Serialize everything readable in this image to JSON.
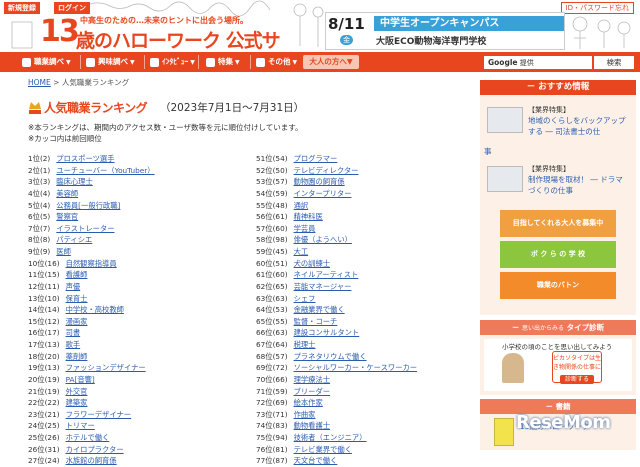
{
  "topbar": {
    "register_label": "新規登録",
    "login_label": "ログイン",
    "forgot_label": "ID・パスワード忘れ",
    "logo_number": "13",
    "logo_tagline": "中高生のための…未来のヒントに出会う場所。",
    "logo_text": "歳のハローワーク 公式サイト",
    "banner_date": "8/11",
    "banner_day": "金",
    "banner_title": "中学生オープンキャンパス",
    "banner_school": "大阪ECO動物海洋専門学校"
  },
  "nav": {
    "items": [
      "職業調べ",
      "興味調べ",
      "ｲﾝﾀﾋﾞｭｰ",
      "特集",
      "その他"
    ],
    "pill_label": "大人の方へ",
    "search_brand": "Google",
    "search_placeholder": "提供",
    "search_button": "検索"
  },
  "breadcrumb": {
    "home": "HOME",
    "separator": ">",
    "current": "人気職業ランキング"
  },
  "ranking": {
    "title": "人気職業ランキング",
    "period": "（2023年7月1日〜7月31日）",
    "note1": "※本ランキングは、期間内のアクセス数・ユーザ数等を元に順位付けしています。",
    "note2": "※カッコ内は前回順位",
    "left": [
      {
        "rank": "1位(2)",
        "name": "プロスポーツ選手"
      },
      {
        "rank": "2位(1)",
        "name": "ユーチューバー（YouTuber）"
      },
      {
        "rank": "3位(3)",
        "name": "臨床心理士"
      },
      {
        "rank": "4位(4)",
        "name": "美容師"
      },
      {
        "rank": "5位(4)",
        "name": "公務員[一般行政職]"
      },
      {
        "rank": "6位(5)",
        "name": "警察官"
      },
      {
        "rank": "7位(7)",
        "name": "イラストレーター"
      },
      {
        "rank": "8位(8)",
        "name": "パティシエ"
      },
      {
        "rank": "9位(9)",
        "name": "医師"
      },
      {
        "rank": "10位(16)",
        "name": "自然観察指導員"
      },
      {
        "rank": "11位(15)",
        "name": "看護師"
      },
      {
        "rank": "12位(11)",
        "name": "声優"
      },
      {
        "rank": "13位(10)",
        "name": "保育士"
      },
      {
        "rank": "14位(14)",
        "name": "中学校・高校教師"
      },
      {
        "rank": "15位(12)",
        "name": "漫画家"
      },
      {
        "rank": "16位(17)",
        "name": "司書"
      },
      {
        "rank": "17位(13)",
        "name": "歌手"
      },
      {
        "rank": "18位(20)",
        "name": "薬剤師"
      },
      {
        "rank": "19位(13)",
        "name": "ファッションデザイナー"
      },
      {
        "rank": "20位(19)",
        "name": "PA[音響]"
      },
      {
        "rank": "21位(19)",
        "name": "外交官"
      },
      {
        "rank": "22位(22)",
        "name": "建築家"
      },
      {
        "rank": "23位(21)",
        "name": "フラワーデザイナー"
      },
      {
        "rank": "24位(25)",
        "name": "トリマー"
      },
      {
        "rank": "25位(26)",
        "name": "ホテルで働く"
      },
      {
        "rank": "26位(31)",
        "name": "カイロプラクター"
      },
      {
        "rank": "27位(24)",
        "name": "水族館の飼育係"
      }
    ],
    "right": [
      {
        "rank": "51位(54)",
        "name": "プログラマー"
      },
      {
        "rank": "52位(50)",
        "name": "テレビディレクター"
      },
      {
        "rank": "53位(57)",
        "name": "動物園の飼育係"
      },
      {
        "rank": "54位(59)",
        "name": "インタープリター"
      },
      {
        "rank": "55位(48)",
        "name": "通訳"
      },
      {
        "rank": "56位(61)",
        "name": "精神科医"
      },
      {
        "rank": "57位(60)",
        "name": "学芸員"
      },
      {
        "rank": "58位(98)",
        "name": "俳優（ようへい）"
      },
      {
        "rank": "59位(45)",
        "name": "大工"
      },
      {
        "rank": "60位(51)",
        "name": "犬の訓練士"
      },
      {
        "rank": "61位(60)",
        "name": "ネイルアーティスト"
      },
      {
        "rank": "62位(65)",
        "name": "芸能マネージャー"
      },
      {
        "rank": "63位(63)",
        "name": "シェフ"
      },
      {
        "rank": "64位(53)",
        "name": "金融業界で働く"
      },
      {
        "rank": "65位(55)",
        "name": "監督・コーチ"
      },
      {
        "rank": "66位(63)",
        "name": "建設コンサルタント"
      },
      {
        "rank": "67位(64)",
        "name": "税理士"
      },
      {
        "rank": "68位(57)",
        "name": "プラネタリウムで働く"
      },
      {
        "rank": "69位(72)",
        "name": "ソーシャルワーカー・ケースワーカー"
      },
      {
        "rank": "70位(66)",
        "name": "理学療法士"
      },
      {
        "rank": "71位(59)",
        "name": "ブリーダー"
      },
      {
        "rank": "72位(69)",
        "name": "絵本作家"
      },
      {
        "rank": "73位(71)",
        "name": "作曲家"
      },
      {
        "rank": "74位(83)",
        "name": "動物看護士"
      },
      {
        "rank": "75位(94)",
        "name": "技術者（エンジニア）"
      },
      {
        "rank": "76位(81)",
        "name": "テレビ業界で働く"
      },
      {
        "rank": "77位(87)",
        "name": "天文台で働く"
      }
    ]
  },
  "sidebar": {
    "recommend_header": "おすすめ情報",
    "feature1_tag": "【業界特集】",
    "feature1_text": "地域のくらしをバックアップする ― 司法書士の仕",
    "feature1_tail": "事",
    "feature2_tag": "【業界特集】",
    "feature2_text": "制作現場を取材！ ― ドラマづくりの仕事",
    "banner1": "目指してくれる大人を募集中",
    "banner2": "ボ ク ら の 学 校",
    "banner3": "職業のバトン",
    "diagnosis_header": "タイプ診断",
    "diagnosis_prefix": "思い出からみる",
    "diagnosis_question": "小学校の頃のことを思い出してみよう",
    "diagnosis_card": "ピカソタイプは生き物関係の仕事に",
    "diagnosis_button": "診断する",
    "books_header": "書籍",
    "book_title": "13歳のハローワーク"
  },
  "watermark": "ReseMom"
}
